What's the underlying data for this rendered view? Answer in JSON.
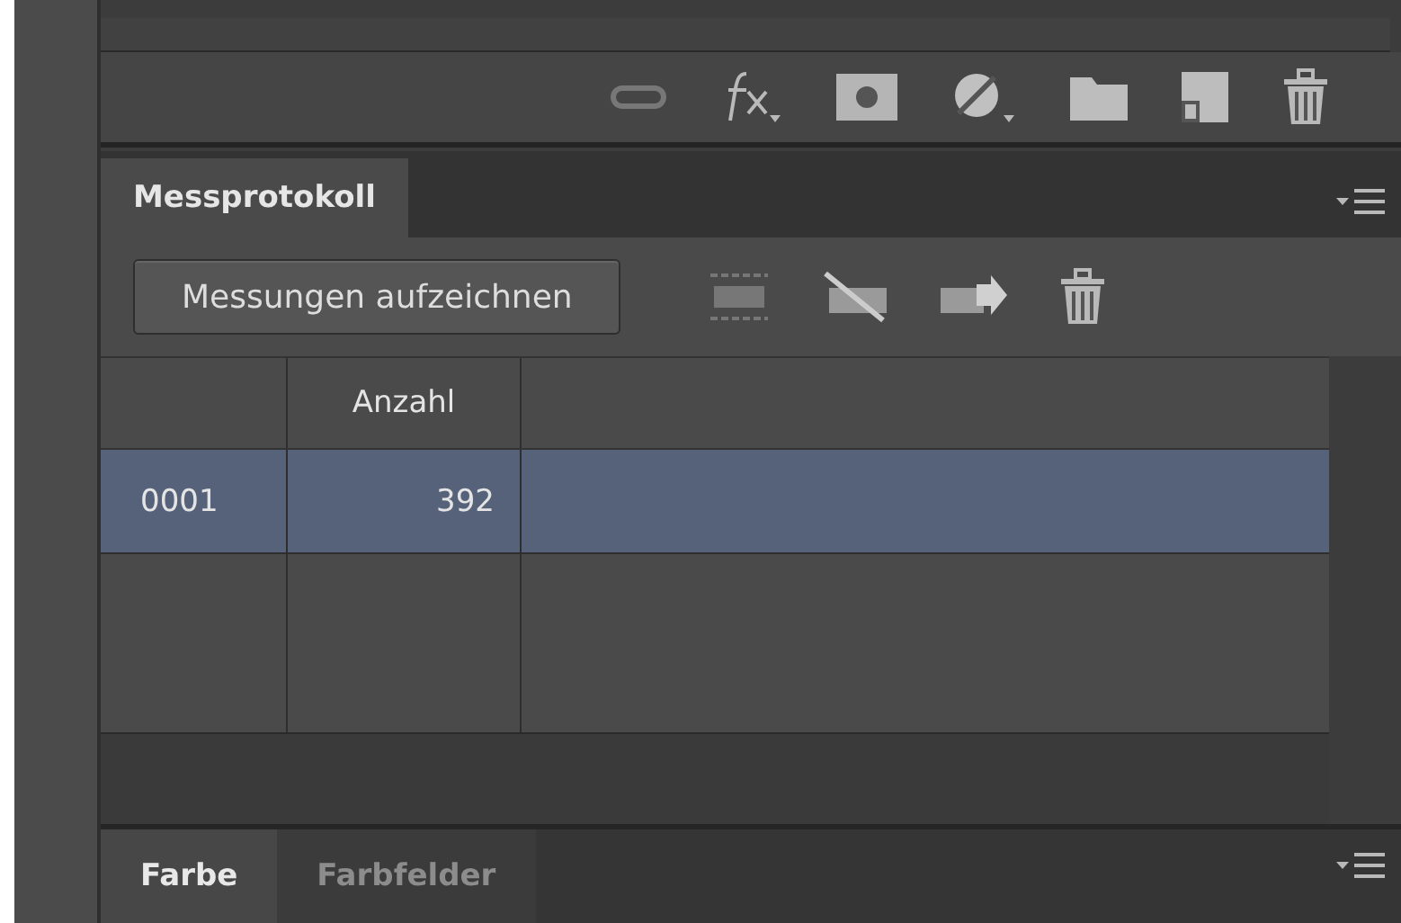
{
  "panel_tabs": [
    {
      "label": "Messprotokoll",
      "selected": true
    }
  ],
  "record_button": {
    "label": "Messungen aufzeichnen"
  },
  "table": {
    "columns": [
      {
        "label": "Anzahl"
      }
    ],
    "rows": [
      {
        "cells": [
          "0001",
          "392"
        ],
        "selected": true
      }
    ]
  },
  "bottom_tabs": [
    {
      "label": "Farbe",
      "selected": true
    },
    {
      "label": "Farbfelder",
      "selected": false
    }
  ]
}
